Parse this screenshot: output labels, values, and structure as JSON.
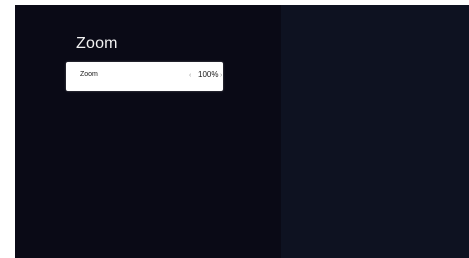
{
  "page": {
    "title": "Zoom"
  },
  "zoom_setting": {
    "label": "Zoom",
    "value": "100%",
    "prev_icon": "chevron-left-icon",
    "next_icon": "chevron-right-icon"
  },
  "colors": {
    "background_left": "#0a0a16",
    "background_right": "#0e1221",
    "row_background": "#ffffff",
    "title_text": "#f2f2f2",
    "row_text": "#1a1a1a"
  }
}
